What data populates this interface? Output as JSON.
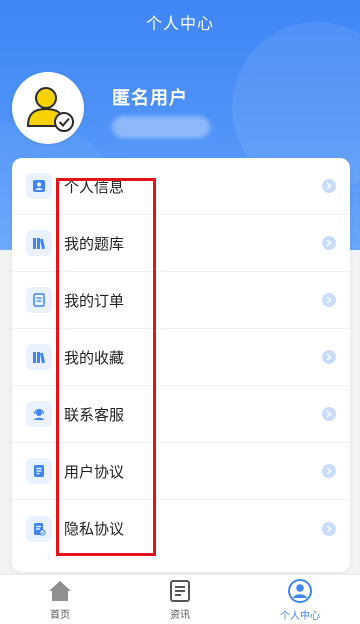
{
  "header": {
    "title": "个人中心"
  },
  "profile": {
    "username": "匿名用户",
    "avatar_icon": "user-check-icon"
  },
  "menu": [
    {
      "label": "个人信息",
      "icon": "id-card-icon"
    },
    {
      "label": "我的题库",
      "icon": "books-icon"
    },
    {
      "label": "我的订单",
      "icon": "order-document-icon"
    },
    {
      "label": "我的收藏",
      "icon": "books-icon"
    },
    {
      "label": "联系客服",
      "icon": "customer-service-icon"
    },
    {
      "label": "用户协议",
      "icon": "document-icon"
    },
    {
      "label": "隐私协议",
      "icon": "privacy-document-icon"
    }
  ],
  "tabbar": [
    {
      "label": "首页",
      "icon": "home-icon",
      "active": false
    },
    {
      "label": "资讯",
      "icon": "news-icon",
      "active": false
    },
    {
      "label": "个人中心",
      "icon": "profile-icon",
      "active": true
    }
  ],
  "colors": {
    "primary": "#3f86f5",
    "highlight_box": "#e3121b",
    "icon_bg": "#eaf2ff"
  }
}
